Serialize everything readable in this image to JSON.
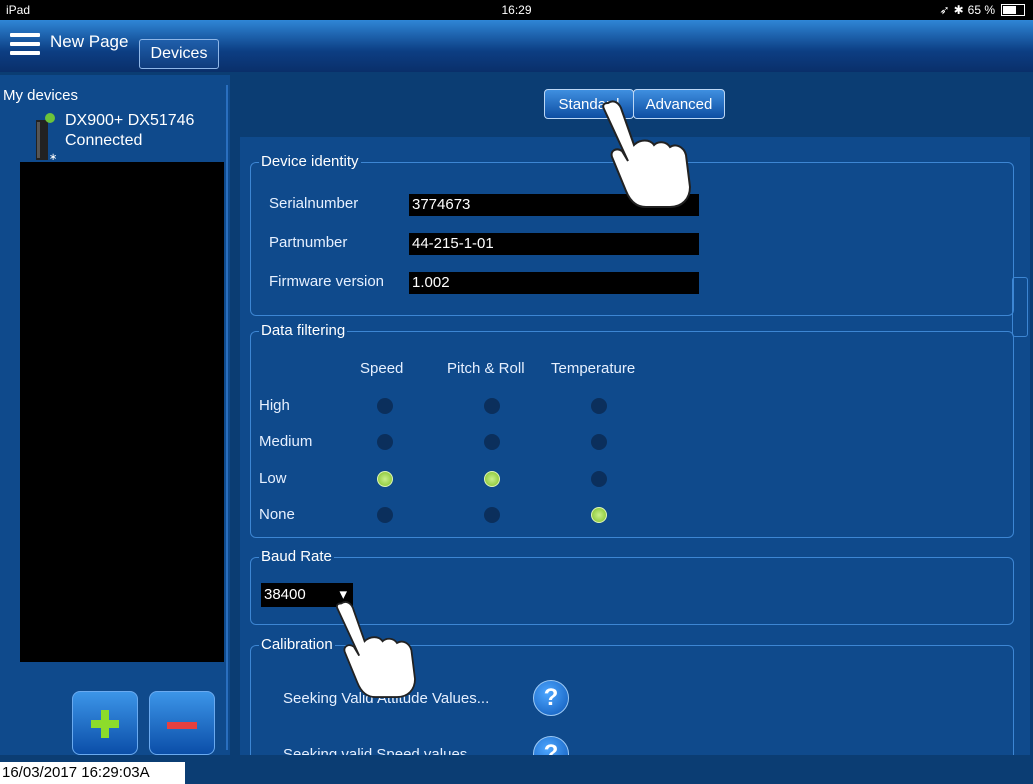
{
  "status": {
    "device": "iPad",
    "time": "16:29",
    "battery": "65 %"
  },
  "nav": {
    "title": "New Page",
    "tab": "Devices"
  },
  "sidebar": {
    "heading": "My devices",
    "device": {
      "name": "DX900+ DX51746",
      "status": "Connected"
    }
  },
  "segments": {
    "standard": "Standard",
    "advanced": "Advanced"
  },
  "identity": {
    "title": "Device identity",
    "serial_label": "Serialnumber",
    "serial_value": "3774673",
    "part_label": "Partnumber",
    "part_value": "44-215-1-01",
    "fw_label": "Firmware version",
    "fw_value": "1.002"
  },
  "filtering": {
    "title": "Data filtering",
    "columns": [
      "Speed",
      "Pitch & Roll",
      "Temperature"
    ],
    "rows": [
      "High",
      "Medium",
      "Low",
      "None"
    ],
    "selected": {
      "Speed": "Low",
      "Pitch & Roll": "Low",
      "Temperature": "None"
    }
  },
  "baud": {
    "title": "Baud Rate",
    "value": "38400"
  },
  "calibration": {
    "title": "Calibration",
    "item1": "Seeking Valid Attitude Values...",
    "item2": "Seeking valid Speed values..."
  },
  "footer": {
    "timestamp": "16/03/2017 16:29:03A"
  },
  "colors": {
    "accent": "#2f86d6",
    "selected_radio": "#8ddc2b",
    "remove": "#e64040"
  }
}
